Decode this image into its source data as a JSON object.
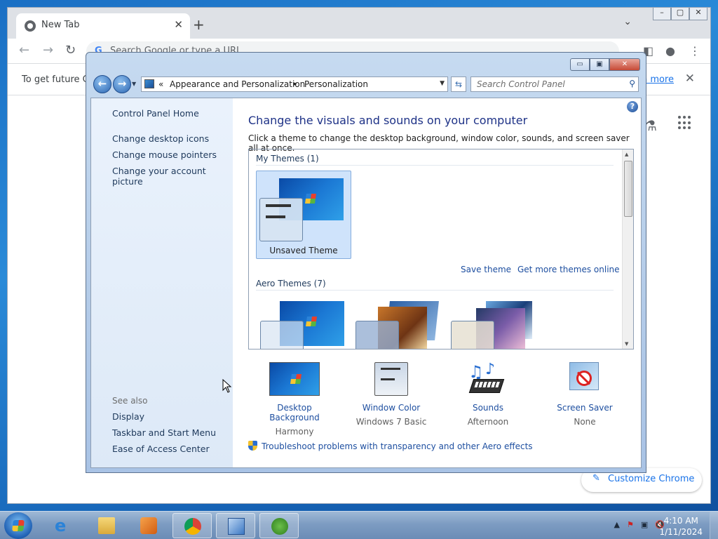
{
  "chrome": {
    "tab_title": "New Tab",
    "tab_close": "✕",
    "new_tab": "+",
    "tab_search": "⌄",
    "window_buttons": [
      "–",
      "▢",
      "✕"
    ],
    "omnibox_placeholder": "Search Google or type a URL",
    "infobar_text": "To get future Go",
    "infobar_link": "rn more",
    "infobar_close": "✕",
    "customize_label": "Customize Chrome"
  },
  "cp": {
    "caption_buttons": {
      "min": "▭",
      "max": "▣",
      "close": "✕"
    },
    "breadcrumb": [
      "«",
      "Appearance and Personalization",
      "▸",
      "Personalization"
    ],
    "search_placeholder": "Search Control Panel",
    "help": "?",
    "left": {
      "home": "Control Panel Home",
      "links": [
        "Change desktop icons",
        "Change mouse pointers",
        "Change your account picture"
      ],
      "see_also_label": "See also",
      "see_also": [
        "Display",
        "Taskbar and Start Menu",
        "Ease of Access Center"
      ]
    },
    "main": {
      "title": "Change the visuals and sounds on your computer",
      "description": "Click a theme to change the desktop background, window color, sounds, and screen saver all at once.",
      "my_themes_header": "My Themes (1)",
      "unsaved_theme_label": "Unsaved Theme",
      "save_theme": "Save theme",
      "get_more_themes": "Get more themes online",
      "aero_themes_header": "Aero Themes (7)"
    },
    "bottom_items": [
      {
        "title": "Desktop Background",
        "subtitle": "Harmony",
        "icon": "desktop-background-icon"
      },
      {
        "title": "Window Color",
        "subtitle": "Windows 7 Basic",
        "icon": "window-color-icon"
      },
      {
        "title": "Sounds",
        "subtitle": "Afternoon",
        "icon": "sounds-icon"
      },
      {
        "title": "Screen Saver",
        "subtitle": "None",
        "icon": "screen-saver-icon"
      }
    ],
    "troubleshoot": "Troubleshoot problems with transparency and other Aero effects"
  },
  "taskbar": {
    "clock_time": "4:10 AM",
    "clock_date": "1/11/2024",
    "tray_icons": [
      "▲",
      "⚑",
      "▣",
      "🔇"
    ]
  }
}
